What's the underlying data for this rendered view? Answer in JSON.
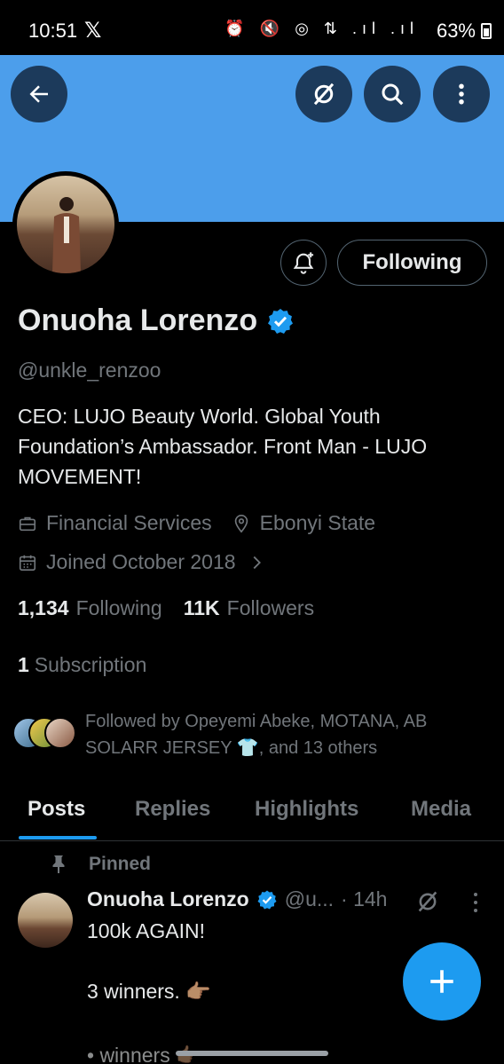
{
  "status_bar": {
    "time": "10:51",
    "app_glyph": "𝕏",
    "system_icons": "⏰ 🔇 ◎ ⇅ .ıl .ıl",
    "battery": "63%"
  },
  "colors": {
    "banner": "#4c9eeb",
    "accent": "#1d9bf0",
    "verified": "#1d9bf0",
    "muted": "#71767b"
  },
  "profile": {
    "name": "Onuoha Lorenzo",
    "handle": "@unkle_renzoo",
    "bio": "CEO: LUJO Beauty World. Global Youth Foundation’s Ambassador. Front Man - LUJO MOVEMENT!",
    "category": "Financial Services",
    "location": "Ebonyi State",
    "joined": "Joined October 2018",
    "following_count": "1,134",
    "following_label": "Following",
    "followers_count": "11K",
    "followers_label": "Followers",
    "subscriptions_count": "1",
    "subscriptions_label": "Subscription",
    "followed_by": "Followed by Opeyemi Abeke, MOTANA, AB SOLARR JERSEY 👕, and 13 others"
  },
  "actions": {
    "following_button": "Following"
  },
  "icons": [
    "back-arrow-icon",
    "grok-icon",
    "search-icon",
    "more-vertical-icon",
    "bell-plus-icon",
    "verified-badge-icon",
    "briefcase-icon",
    "location-pin-icon",
    "calendar-icon",
    "chevron-right-icon",
    "pin-icon",
    "plus-icon"
  ],
  "tabs": [
    {
      "label": "Posts",
      "active": true
    },
    {
      "label": "Replies",
      "active": false
    },
    {
      "label": "Highlights",
      "active": false
    },
    {
      "label": "Media",
      "active": false
    }
  ],
  "pinned_post": {
    "pinned_label": "Pinned",
    "author_name": "Onuoha Lorenzo",
    "author_handle": "@u...",
    "time": "· 14h",
    "line1": "100k AGAIN!",
    "line2": "3 winners. 👉🏽",
    "line3": "• winners 👉🏽"
  }
}
